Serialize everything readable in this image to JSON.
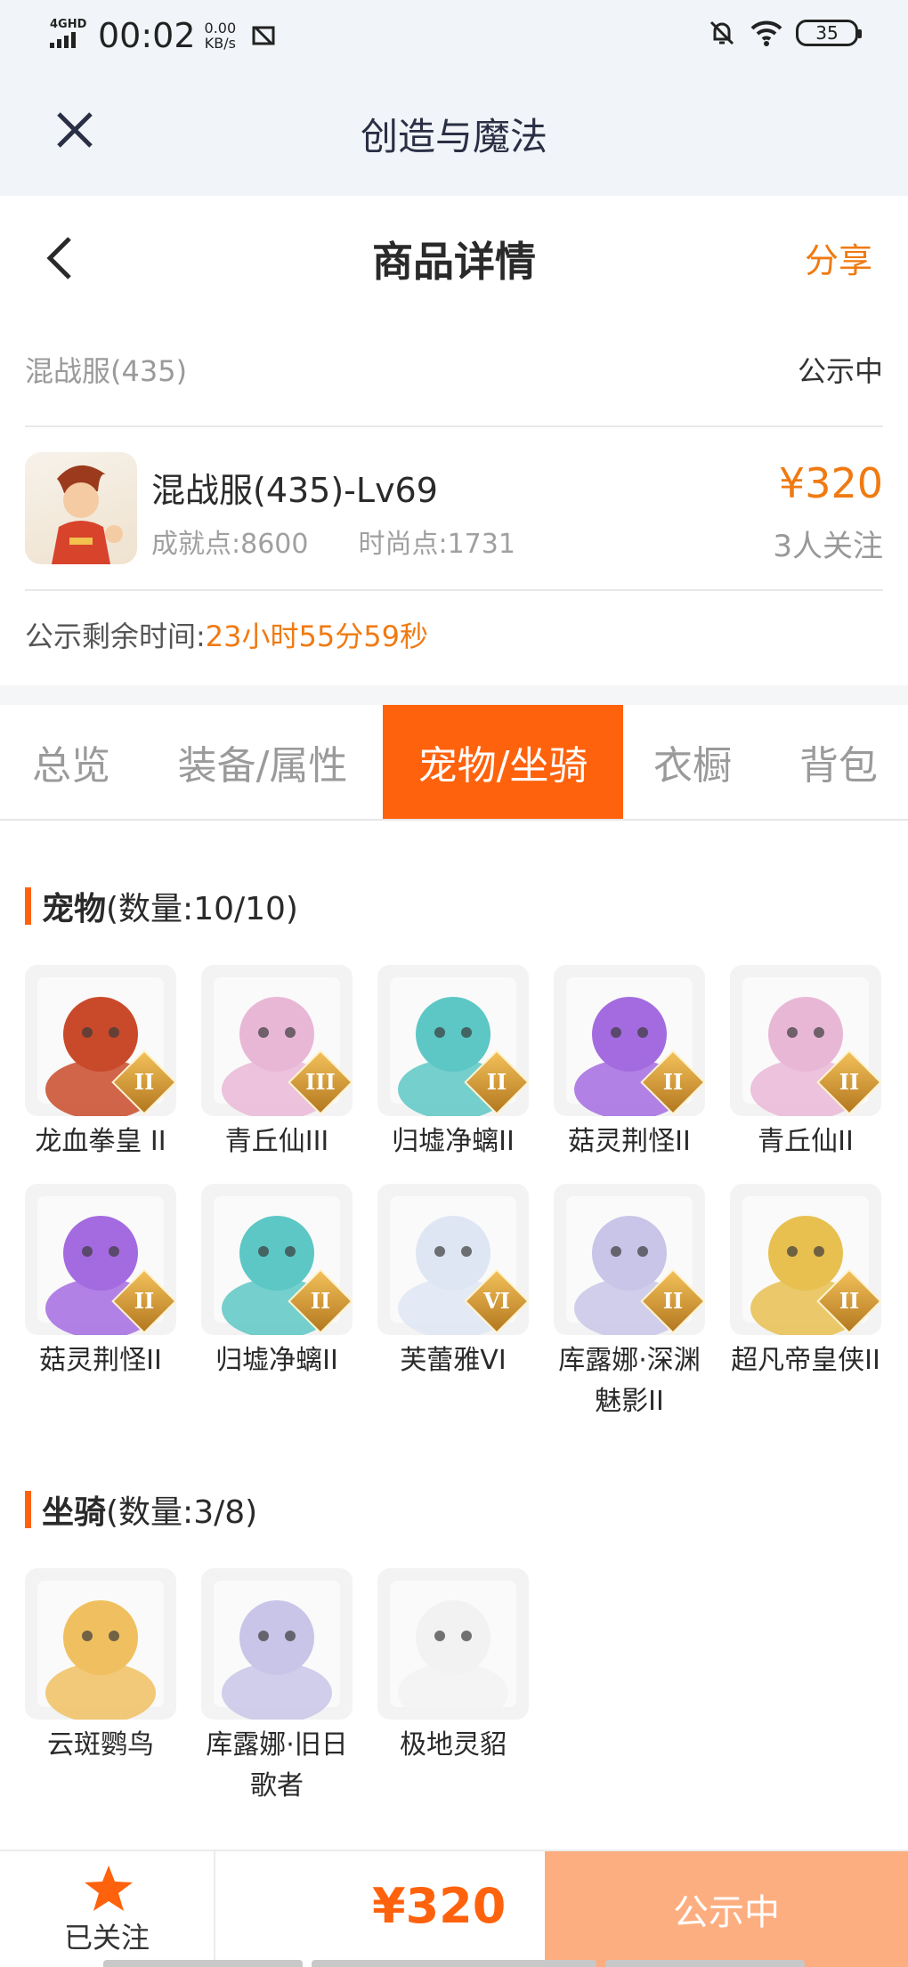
{
  "status_bar": {
    "network": "4GHD",
    "time": "00:02",
    "speed_value": "0.00",
    "speed_unit": "KB/s",
    "battery": "35"
  },
  "app": {
    "title": "创造与魔法"
  },
  "header": {
    "title": "商品详情",
    "share": "分享"
  },
  "listing": {
    "server": "混战服(435)",
    "status": "公示中",
    "character_name": "混战服(435)-Lv69",
    "achievement": "成就点:8600",
    "fashion": "时尚点:1731",
    "price": "¥320",
    "followers": "3人关注",
    "remaining_label": "公示剩余时间:",
    "remaining_value": "23小时55分59秒"
  },
  "tabs": [
    "总览",
    "装备/属性",
    "宠物/坐骑",
    "衣橱",
    "背包"
  ],
  "active_tab": "宠物/坐骑",
  "pets": {
    "title": "宠物",
    "count": "(数量:10/10)",
    "items": [
      {
        "name": "龙血拳皇 II",
        "badge": "II",
        "color": "#c94a2a"
      },
      {
        "name": "青丘仙III",
        "badge": "III",
        "color": "#e9b7d6"
      },
      {
        "name": "归墟净螭II",
        "badge": "II",
        "color": "#5cc7c4"
      },
      {
        "name": "菇灵荆怪II",
        "badge": "II",
        "color": "#a46be0"
      },
      {
        "name": "青丘仙II",
        "badge": "II",
        "color": "#e9b7d6"
      },
      {
        "name": "菇灵荆怪II",
        "badge": "II",
        "color": "#a46be0"
      },
      {
        "name": "归墟净螭II",
        "badge": "II",
        "color": "#5cc7c4"
      },
      {
        "name": "芙蕾雅VI",
        "badge": "VI",
        "color": "#dfe6f3"
      },
      {
        "name": "库露娜·深渊魅影II",
        "badge": "II",
        "color": "#c9c5e8"
      },
      {
        "name": "超凡帝皇侠II",
        "badge": "II",
        "color": "#e8c050"
      }
    ]
  },
  "mounts": {
    "title": "坐骑",
    "count": "(数量:3/8)",
    "items": [
      {
        "name": "云斑鹦鸟",
        "badge": "",
        "color": "#f0c060"
      },
      {
        "name": "库露娜·旧日歌者",
        "badge": "",
        "color": "#c9c5e8"
      },
      {
        "name": "极地灵貂",
        "badge": "",
        "color": "#f2f2f2"
      }
    ]
  },
  "bottom_bar": {
    "follow_label": "已关注",
    "price": "¥320",
    "status_button": "公示中"
  }
}
